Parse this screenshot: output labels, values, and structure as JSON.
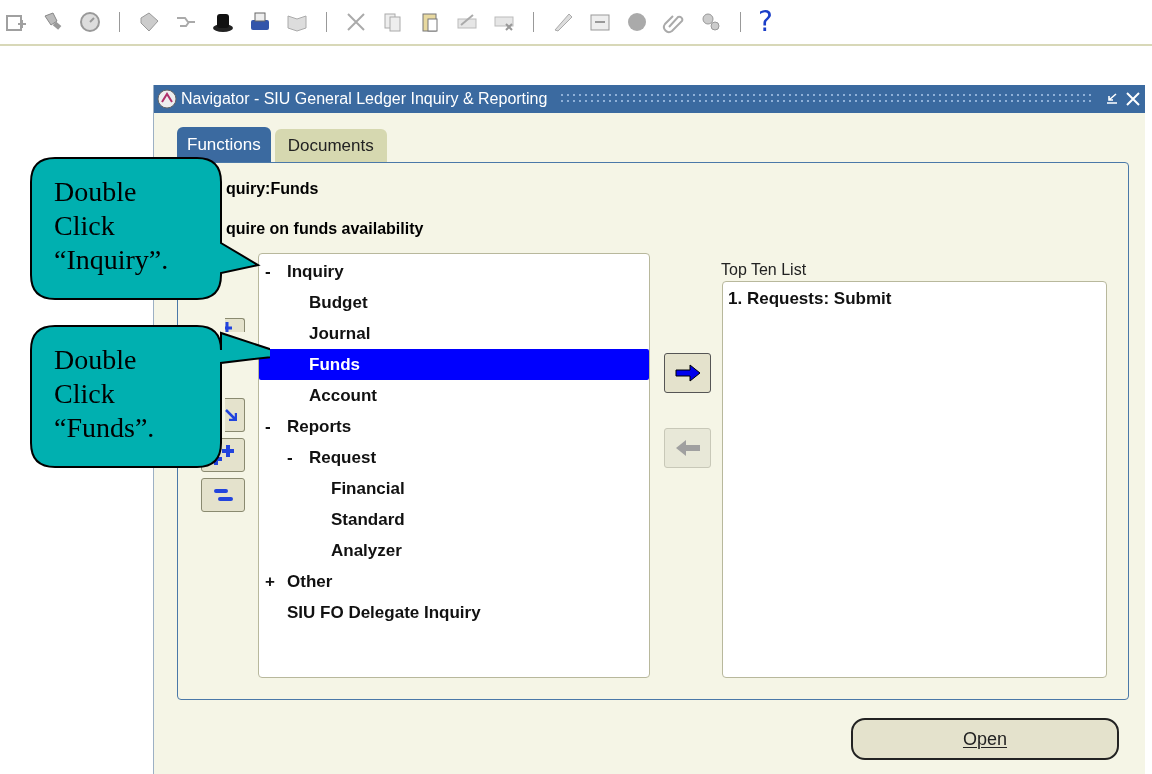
{
  "toolbar": {
    "help": "?"
  },
  "window": {
    "title": "Navigator - SIU General Ledger Inquiry & Reporting"
  },
  "tabs": [
    {
      "label": "Functions",
      "selected": true
    },
    {
      "label": "Documents",
      "selected": false
    }
  ],
  "function_name": "quiry:Funds",
  "function_description": "quire on funds availability",
  "tree": [
    {
      "label": "Inquiry",
      "toggle": "-",
      "selected": false,
      "children": [
        {
          "label": "Budget",
          "selected": false
        },
        {
          "label": "Journal",
          "selected": false
        },
        {
          "label": "Funds",
          "selected": true
        },
        {
          "label": "Account",
          "selected": false
        }
      ]
    },
    {
      "label": "Reports",
      "toggle": "-",
      "selected": false,
      "children": [
        {
          "label": "Request",
          "toggle": "-",
          "selected": false,
          "children": [
            {
              "label": "Financial",
              "selected": false
            },
            {
              "label": "Standard",
              "selected": false
            },
            {
              "label": "Analyzer",
              "selected": false
            }
          ]
        }
      ]
    },
    {
      "label": "Other",
      "toggle": "+",
      "selected": false
    },
    {
      "label": "SIU FO Delegate Inquiry",
      "selected": false
    }
  ],
  "move_buttons": [
    {
      "kind": "add",
      "disabled": false
    },
    {
      "kind": "remove",
      "disabled": true
    }
  ],
  "top_ten": {
    "label": "Top Ten List",
    "items": [
      "1. Requests: Submit"
    ]
  },
  "open_button": {
    "label": "Open"
  },
  "callouts": [
    {
      "lines": [
        "Double",
        "Click",
        "“Inquiry”."
      ]
    },
    {
      "lines": [
        "Double",
        "Click",
        "“Funds”."
      ]
    }
  ]
}
